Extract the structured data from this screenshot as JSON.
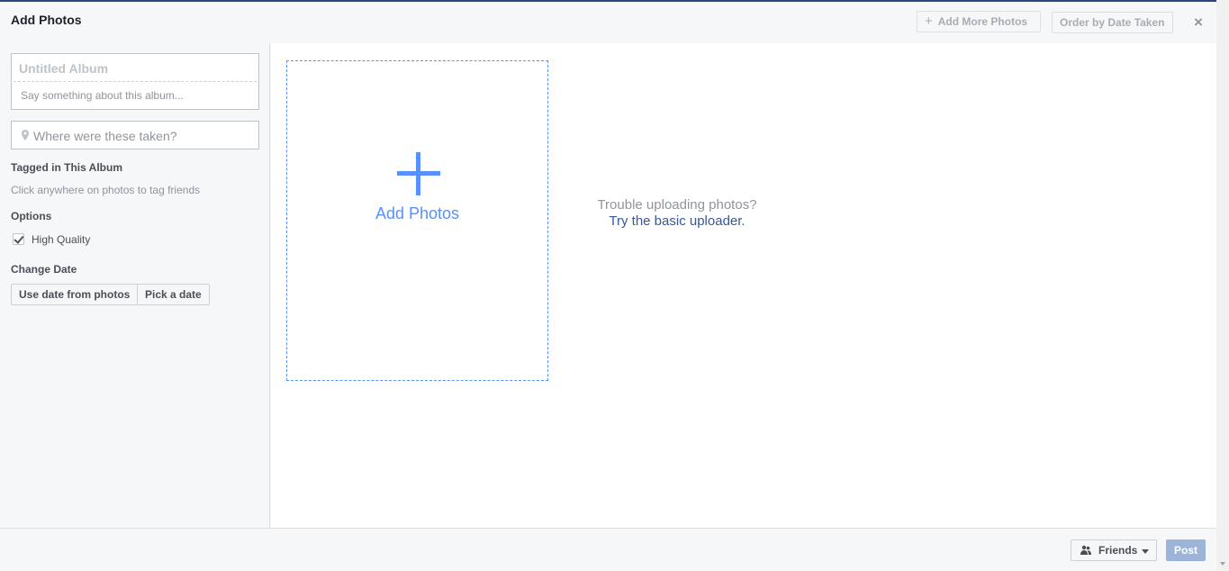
{
  "header": {
    "title": "Add Photos",
    "add_more_label": "Add More Photos",
    "order_label": "Order by Date Taken",
    "close_glyph": "×"
  },
  "sidebar": {
    "album_title_placeholder": "Untitled Album",
    "album_description_placeholder": "Say something about this album...",
    "location_placeholder": "Where were these taken?",
    "tagged_heading": "Tagged in This Album",
    "tagged_hint": "Click anywhere on photos to tag friends",
    "options_heading": "Options",
    "high_quality_label": "High Quality",
    "high_quality_checked": true,
    "change_date_heading": "Change Date",
    "use_date_label": "Use date from photos",
    "pick_date_label": "Pick a date"
  },
  "main": {
    "dropzone_label": "Add Photos",
    "trouble_text": "Trouble uploading photos?",
    "basic_uploader_link": "Try the basic uploader."
  },
  "footer": {
    "audience_label": "Friends",
    "post_label": "Post"
  },
  "colors": {
    "accent": "#5890ff",
    "link": "#365899",
    "post_disabled": "#9cb4d8"
  },
  "icons": {
    "location": "map-pin-icon",
    "audience": "friends-icon",
    "close": "close-icon",
    "add": "plus-icon"
  }
}
